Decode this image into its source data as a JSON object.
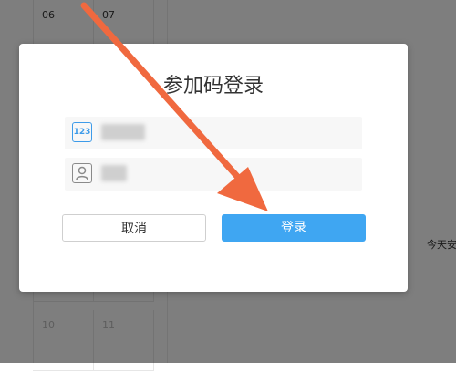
{
  "calendar": {
    "days": [
      "06",
      "07",
      "10",
      "11"
    ],
    "side_text": "今天安"
  },
  "modal": {
    "title": "参加码登录",
    "code_field": {
      "icon": "123",
      "value_obscured": true
    },
    "name_field": {
      "icon": "user-icon",
      "value_obscured": true
    },
    "cancel_label": "取消",
    "login_label": "登录"
  },
  "colors": {
    "primary": "#3fa6f2",
    "arrow": "#f0693f",
    "code_icon": "#3d9be9"
  }
}
